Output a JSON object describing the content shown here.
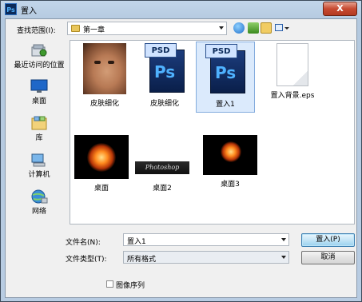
{
  "window": {
    "title": "置入",
    "close_label": "X",
    "app_icon_text": "Ps"
  },
  "toolbar": {
    "lookin_label": "查找范围(I):",
    "lookin_value": "第一章"
  },
  "places": [
    {
      "label": "最近访问的位置",
      "icon": "recent-places-icon"
    },
    {
      "label": "桌面",
      "icon": "desktop-icon"
    },
    {
      "label": "库",
      "icon": "libraries-icon"
    },
    {
      "label": "计算机",
      "icon": "computer-icon"
    },
    {
      "label": "网络",
      "icon": "network-icon"
    }
  ],
  "files": [
    {
      "name": "皮肤细化",
      "type": "image-face"
    },
    {
      "name": "皮肤细化",
      "type": "psd",
      "tag": "PSD",
      "glyph": "Ps"
    },
    {
      "name": "置入1",
      "type": "psd",
      "tag": "PSD",
      "glyph": "Ps",
      "selected": true
    },
    {
      "name": "置入背景.eps",
      "type": "eps"
    },
    {
      "name": "桌面",
      "type": "image-heart"
    },
    {
      "name": "桌面2",
      "type": "image-script",
      "image_text": "Photoshop"
    },
    {
      "name": "桌面3",
      "type": "image-heart"
    }
  ],
  "bottom": {
    "filename_label": "文件名(N):",
    "filename_value": "置入1",
    "filetype_label": "文件类型(T):",
    "filetype_value": "所有格式",
    "open_label": "置入(P)",
    "cancel_label": "取消",
    "sequence_label": "图像序列"
  }
}
